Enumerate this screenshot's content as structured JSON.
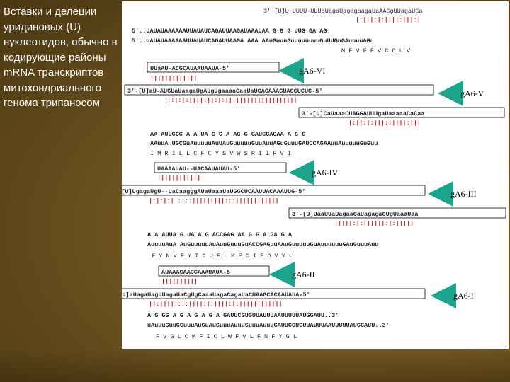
{
  "title": "Вставки и делеции уридиновых (U) нуклеотидов, обычно в кодирующие районы mRNA транскриптов митохондриального генома трипаносом",
  "colors": {
    "background": "#6e5320",
    "insertion_u": "#cc1f1f",
    "guide_anchor": "#1f8a1f",
    "arrow": "#1aa58c",
    "text": "#ffffff"
  },
  "labels": [
    "gA6-VI",
    "gA6-V",
    "gA6-IV",
    "gA6-III",
    "gA6-II",
    "gA6-I"
  ],
  "seq": {
    "r1_guide": "3'-[U]U-UUUU-UUUaUagaUagagaagaUaAACgUUagaUCa",
    "r1_bars": "|:|:|:|:||||:|||:|",
    "r2_mrna1": "5'..UAUAUAAAAAAUUAUAUCAGAUUAAGAUAAAUAA G   G      G UUG GA   AG",
    "r2_mrna2": "5'..UAUAUAAAAAAUUAUAUCAGAUUAAGA AAA AAuGuuuGuuuuuuuuGuUUGuGAuuuuAGu",
    "r2_aa": "M   F   V   F   F   V   C   C   L   V",
    "g6": "UUaAU-ACGCAUAAUAAUA-5'",
    "g6_bars": "|||||||||||||",
    "g5": "3'-[U]aU-AUGUaUaagaUgAUgUgaaaaCaaUaUCACAAACUAGGUCUC-5'",
    "g5_bars": "|:|:|:||||:||:|:||||||||||||||||||||",
    "g5b": "3'-[U]CaUaaaCUAGGAUUUgaUaaaaaCaCaa",
    "g5b_bars": "|:||:|:|||:|||||:|||",
    "r4_mrna1": "AA  AUUGCG A    A UA G     G   A AG G     GAUCCAGAA A      G G",
    "r4_mrna2": "AAuuA  UGCGuAuuuuuAuUAuGuuuuuGuuAuuAGuGuuuGAUCCAGAAuuAuuuuuGuGuu",
    "r4_aa": "I   M   R   I   L   L   C   F   C   Y   S   V   W   S   R   I   I   F   V   I",
    "g4": "UAAAAUAU--UACAAUAUAU-5'",
    "g4_bars": "||||||||||||",
    "g3": "3'-[U]UgagaUgU--UaCaagggAUaUaaaUaUGGCUCAAUUACAAAUUG-5'",
    "g3_bars": "|:|:|:|   ::::|||||||||:::||||||||||||",
    "g2a": "3'-[U]UaaUUaUagaaCaUagagaCUgUaaaUaa",
    "g2a_bars": "|||||:|:||||||:|:|||||",
    "r6_mrna1": "A    A AUUA G       UA A    G ACCGAG  AA G     G A      GA G    A",
    "r6_mrna2": "AuuuuAuA   AuGuuuuuAuAuuGuuuGuACCGAGuuAAuGuuuuuGuAuuuuuuGAuGuuuAuu",
    "r6_aa": "F   Y   N     V   F   Y   I   C   U   E   L   M   F   C   I   F   D   V   Y   L",
    "g2": "AUAAACAACCAAAUAUA-5'",
    "g2_bars": "||||||||||",
    "g1": "3'-[U]aUagaUagUUagaUaCgUgCaaaUagaCagaUaCUAAGCACAAUAUA-5'",
    "g1_bars": "||:||||::::||||:|:||||:|:||||||||||||",
    "r8_mrna1": "A   G   GG   A G A G    A   G     A GAUUCGUGUUAUUUAAUUUUUAUGGAUU..3'",
    "r8_mrna2": "uAuuuGuuGGuuuAuGuAuGuuuAuuuGuuuAuuuGAUUCGUGUUAUUUAAUUUUUAUGGAUU..3'",
    "r8_aa": "F   V   G   L   C   M   F   I   C   L   W   F   V   L   F   N   F   Y   G   L"
  }
}
